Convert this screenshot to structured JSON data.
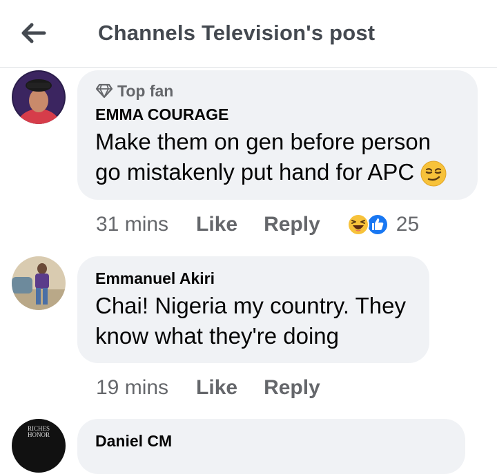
{
  "header": {
    "title": "Channels Television's post"
  },
  "comments": [
    {
      "badge": "Top fan",
      "author": "EMMA COURAGE",
      "lines": [
        "Make them on gen before person",
        "go mistakenly put hand for APC"
      ],
      "time": "31 mins",
      "like_label": "Like",
      "reply_label": "Reply",
      "reaction_count": "25"
    },
    {
      "author": "Emmanuel Akiri",
      "lines": [
        "Chai! Nigeria my country. They",
        "know what they're doing"
      ],
      "time": "19 mins",
      "like_label": "Like",
      "reply_label": "Reply"
    },
    {
      "author": "Daniel CM",
      "avatar_text": [
        "RICHES",
        "HONOR"
      ]
    }
  ],
  "colors": {
    "bubble": "#f0f2f5",
    "like_blue": "#1877f2",
    "secondary_text": "#65676b",
    "header_text": "#444950"
  }
}
